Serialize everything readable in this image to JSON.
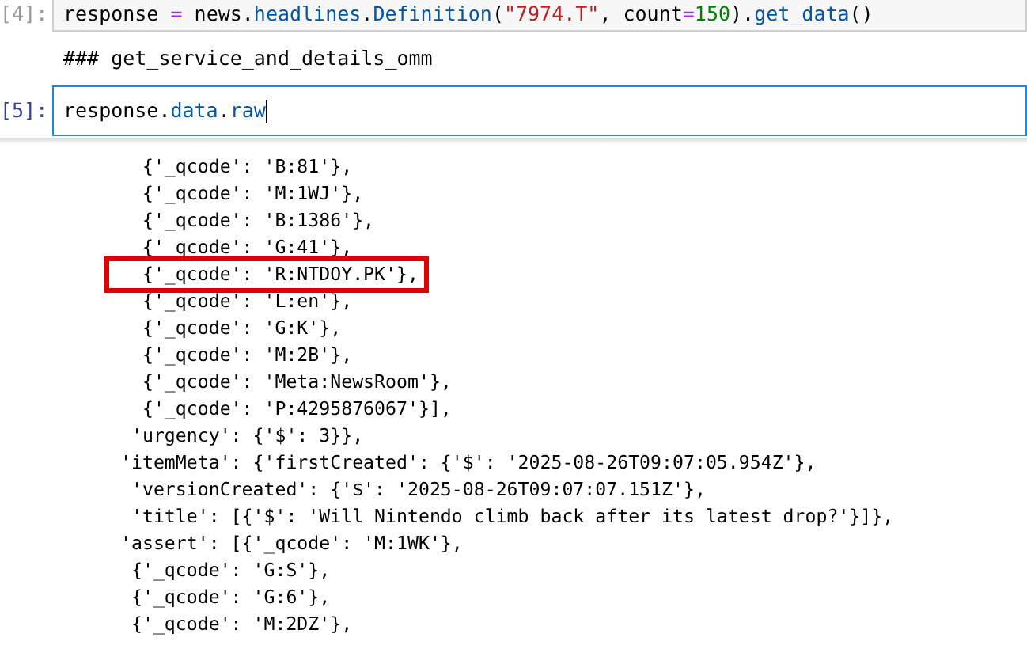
{
  "cells": [
    {
      "kind": "code",
      "prompt": "[4]:",
      "selected": false,
      "tokens": [
        {
          "kind": "name",
          "text": "response "
        },
        {
          "kind": "operator",
          "text": "="
        },
        {
          "kind": "name",
          "text": " news."
        },
        {
          "kind": "attr",
          "text": "headlines"
        },
        {
          "kind": "name",
          "text": "."
        },
        {
          "kind": "attr",
          "text": "Definition"
        },
        {
          "kind": "name",
          "text": "("
        },
        {
          "kind": "string",
          "text": "\"7974.T\""
        },
        {
          "kind": "name",
          "text": ", count"
        },
        {
          "kind": "operator",
          "text": "="
        },
        {
          "kind": "number",
          "text": "150"
        },
        {
          "kind": "name",
          "text": ")."
        },
        {
          "kind": "attr",
          "text": "get_data"
        },
        {
          "kind": "name",
          "text": "()"
        }
      ]
    },
    {
      "kind": "markdown",
      "text": "### get_service_and_details_omm"
    },
    {
      "kind": "code",
      "prompt": "[5]:",
      "selected": true,
      "tokens": [
        {
          "kind": "name",
          "text": "response."
        },
        {
          "kind": "attr",
          "text": "data"
        },
        {
          "kind": "name",
          "text": "."
        },
        {
          "kind": "attr",
          "text": "raw"
        }
      ]
    }
  ],
  "output": {
    "lines": [
      {
        "text": "  {'_qcode': 'B:81'},",
        "highlighted": false
      },
      {
        "text": "  {'_qcode': 'M:1WJ'},",
        "highlighted": false
      },
      {
        "text": "  {'_qcode': 'B:1386'},",
        "highlighted": false
      },
      {
        "text": "  {'_qcode': 'G:41'},",
        "highlighted": false
      },
      {
        "text": "  {'_qcode': 'R:NTDOY.PK'},",
        "highlighted": true
      },
      {
        "text": "  {'_qcode': 'L:en'},",
        "highlighted": false
      },
      {
        "text": "  {'_qcode': 'G:K'},",
        "highlighted": false
      },
      {
        "text": "  {'_qcode': 'M:2B'},",
        "highlighted": false
      },
      {
        "text": "  {'_qcode': 'Meta:NewsRoom'},",
        "highlighted": false
      },
      {
        "text": "  {'_qcode': 'P:4295876067'}],",
        "highlighted": false
      },
      {
        "text": " 'urgency': {'$': 3}},",
        "highlighted": false
      },
      {
        "text": "'itemMeta': {'firstCreated': {'$': '2025-08-26T09:07:05.954Z'},",
        "highlighted": false
      },
      {
        "text": " 'versionCreated': {'$': '2025-08-26T09:07:07.151Z'},",
        "highlighted": false
      },
      {
        "text": " 'title': [{'$': 'Will Nintendo climb back after its latest drop?'}]},",
        "highlighted": false
      },
      {
        "text": "'assert': [{'_qcode': 'M:1WK'},",
        "highlighted": false
      },
      {
        "text": " {'_qcode': 'G:S'},",
        "highlighted": false
      },
      {
        "text": " {'_qcode': 'G:6'},",
        "highlighted": false
      },
      {
        "text": " {'_qcode': 'M:2DZ'},",
        "highlighted": false
      }
    ]
  }
}
